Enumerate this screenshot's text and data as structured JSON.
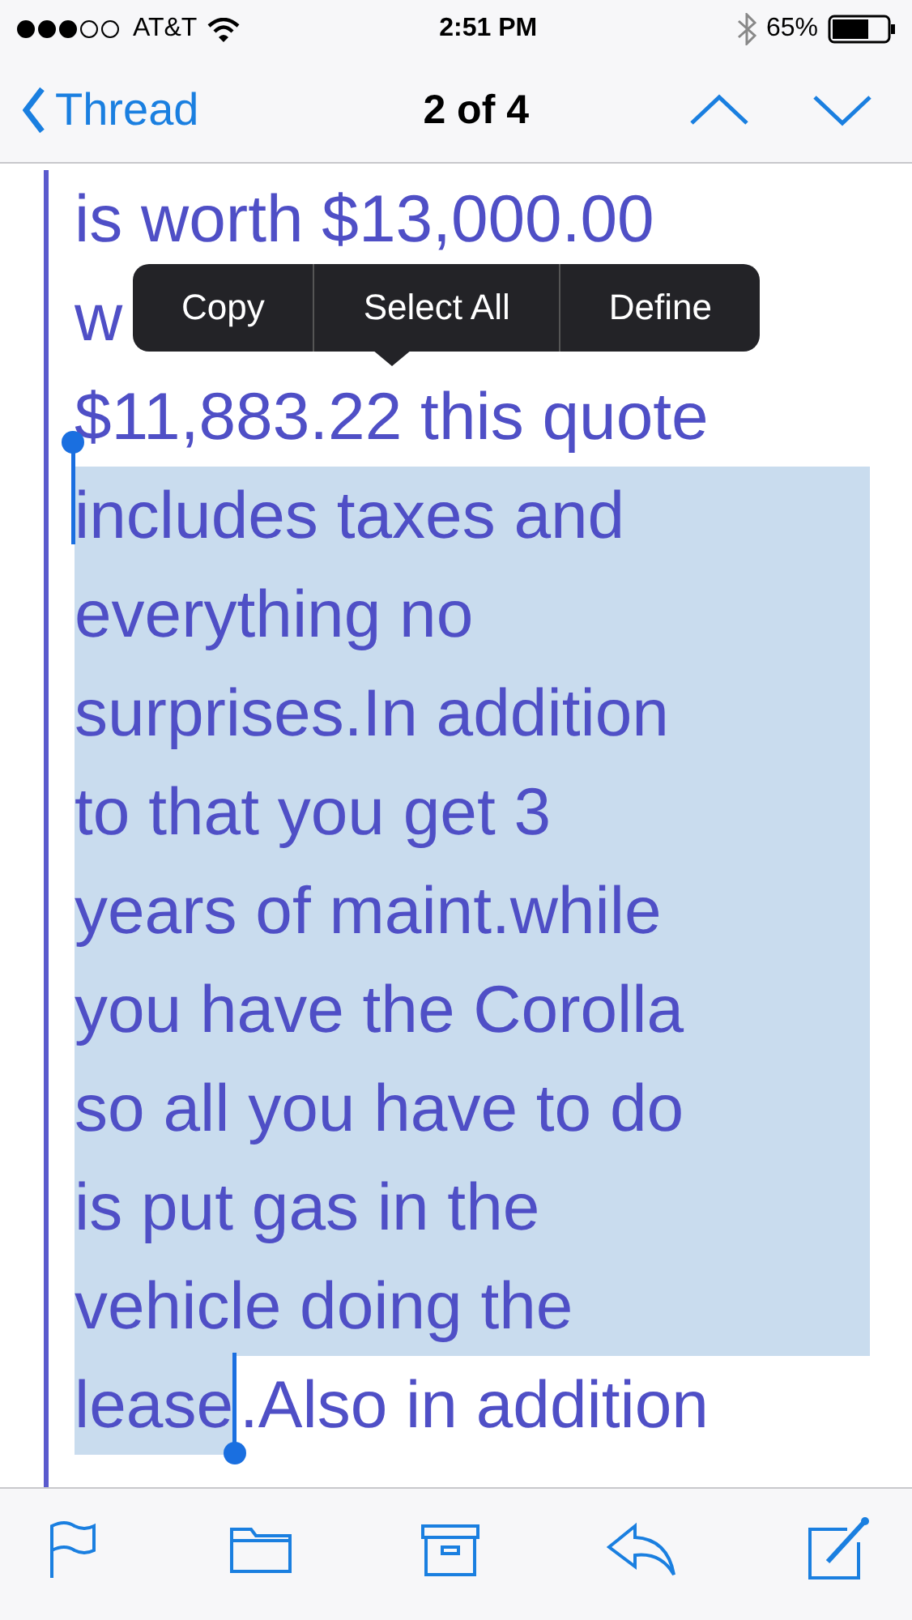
{
  "status_bar": {
    "carrier": "AT&T",
    "time": "2:51 PM",
    "battery": "65%"
  },
  "nav": {
    "back": "Thread",
    "title": "2 of 4"
  },
  "message_lines": [
    {
      "spans": [
        {
          "text": "is worth $13,000.00",
          "selected": false
        }
      ]
    },
    {
      "spans": [
        {
          "text": "w",
          "selected": false
        }
      ]
    },
    {
      "spans": [
        {
          "text": "$11,883.22 this quote",
          "selected": false
        }
      ]
    },
    {
      "spans": [
        {
          "text": "includes taxes and",
          "selected": true
        }
      ]
    },
    {
      "spans": [
        {
          "text": "everything no",
          "selected": true
        }
      ]
    },
    {
      "spans": [
        {
          "text": "surprises.In addition",
          "selected": true
        }
      ]
    },
    {
      "spans": [
        {
          "text": "to that you get 3",
          "selected": true
        }
      ]
    },
    {
      "spans": [
        {
          "text": "years of maint.while",
          "selected": true
        }
      ]
    },
    {
      "spans": [
        {
          "text": "you have the Corolla",
          "selected": true
        }
      ]
    },
    {
      "spans": [
        {
          "text": "so all you have to do",
          "selected": true
        }
      ]
    },
    {
      "spans": [
        {
          "text": "is put gas in the",
          "selected": true
        }
      ]
    },
    {
      "spans": [
        {
          "text": "vehicle doing the",
          "selected": true
        }
      ]
    },
    {
      "spans": [
        {
          "text": "lease",
          "selected": true
        },
        {
          "text": ".Also in addition",
          "selected": false
        }
      ]
    }
  ],
  "edit_menu": [
    "Copy",
    "Select All",
    "Define"
  ]
}
